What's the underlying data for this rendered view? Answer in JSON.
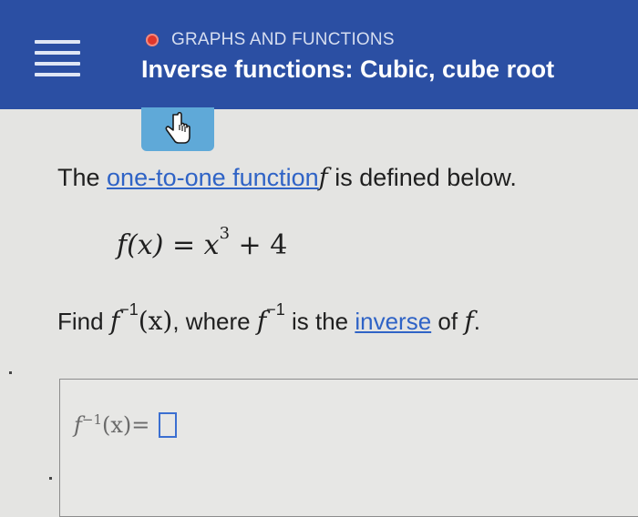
{
  "header": {
    "topic": "GRAPHS AND FUNCTIONS",
    "title": "Inverse functions: Cubic, cube root",
    "menu_icon": "hamburger-menu-icon",
    "topic_dot_color": "#e0362b",
    "background_color": "#2b4fa3"
  },
  "hand_tab": {
    "icon": "pointer-hand-icon",
    "color": "#5fa9d8"
  },
  "problem": {
    "intro_text": "The ",
    "intro_link": "one-to-one function",
    "intro_var": "f",
    "intro_end": " is defined below.",
    "definition_lhs": "f(x) = x",
    "definition_exp": "3",
    "definition_rhs": " + 4",
    "question_find": "Find ",
    "question_f": "f",
    "question_exp": "−1",
    "question_arg": "(x)",
    "question_where": ", where ",
    "question_f2": "f",
    "question_exp2": "−1",
    "question_mid": " is the ",
    "question_link": "inverse",
    "question_of": " of ",
    "question_end_f": "f",
    "question_period": "."
  },
  "answer": {
    "f": "f",
    "exp": "−1",
    "arg": "(x)",
    "equals": " ="
  }
}
